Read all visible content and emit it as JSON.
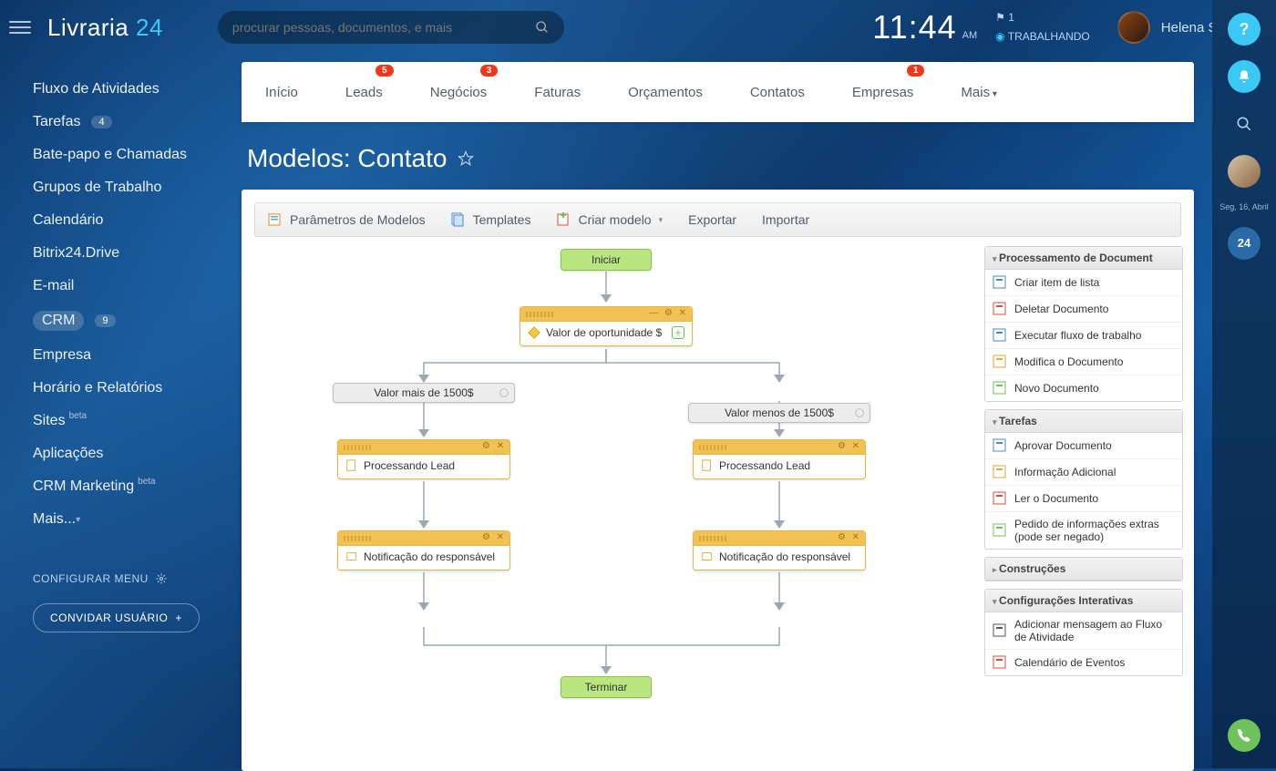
{
  "logo": {
    "name": "Livraria",
    "suffix": "24"
  },
  "search": {
    "placeholder": "procurar pessoas, documentos, e mais"
  },
  "clock": {
    "time": "11:44",
    "ampm": "AM"
  },
  "status": {
    "flag": "⚑ 1",
    "label": "TRABALHANDO"
  },
  "user": {
    "name": "Helena Santos"
  },
  "sidebar": {
    "items": [
      {
        "label": "Fluxo de Atividades"
      },
      {
        "label": "Tarefas",
        "badge": "4"
      },
      {
        "label": "Bate-papo e Chamadas"
      },
      {
        "label": "Grupos de Trabalho"
      },
      {
        "label": "Calendário"
      },
      {
        "label": "Bitrix24.Drive"
      },
      {
        "label": "E-mail"
      },
      {
        "label": "CRM",
        "badge": "9",
        "active": true
      },
      {
        "label": "Empresa"
      },
      {
        "label": "Horário e Relatórios"
      },
      {
        "label": "Sites",
        "sup": "beta"
      },
      {
        "label": "Aplicações"
      },
      {
        "label": "CRM Marketing",
        "sup": "beta"
      },
      {
        "label": "Mais...",
        "more": true
      }
    ],
    "config": "CONFIGURAR MENU",
    "invite": "CONVIDAR USUÁRIO"
  },
  "tabs": [
    {
      "label": "Início"
    },
    {
      "label": "Leads",
      "badge": "5"
    },
    {
      "label": "Negócios",
      "badge": "3"
    },
    {
      "label": "Faturas"
    },
    {
      "label": "Orçamentos"
    },
    {
      "label": "Contatos"
    },
    {
      "label": "Empresas",
      "badge": "1"
    },
    {
      "label": "Mais",
      "more": true
    }
  ],
  "page_title": "Modelos: Contato",
  "toolbar": {
    "params": "Parâmetros de Modelos",
    "templates": "Templates",
    "create": "Criar modelo",
    "export": "Exportar",
    "import": "Importar"
  },
  "flow": {
    "start": "Iniciar",
    "decision": "Valor de oportunidade $",
    "branch_left": "Valor mais de 1500$",
    "branch_right": "Valor menos de 1500$",
    "process": "Processando Lead",
    "notify": "Notificação do responsável",
    "end": "Terminar"
  },
  "palette": {
    "g1": {
      "title": "Processamento de Document",
      "items": [
        "Criar item de lista",
        "Deletar Documento",
        "Executar fluxo de trabalho",
        "Modifica o Documento",
        "Novo Documento"
      ]
    },
    "g2": {
      "title": "Tarefas",
      "items": [
        "Aprovar Documento",
        "Informação Adicional",
        "Ler o Documento",
        "Pedido de informações extras (pode ser negado)"
      ]
    },
    "g3": {
      "title": "Construções"
    },
    "g4": {
      "title": "Configurações Interativas",
      "items": [
        "Adicionar mensagem ao Fluxo de Atividade",
        "Calendário de Eventos"
      ]
    }
  },
  "rail": {
    "date": "Seg, 16, Abril",
    "brand": "24"
  }
}
